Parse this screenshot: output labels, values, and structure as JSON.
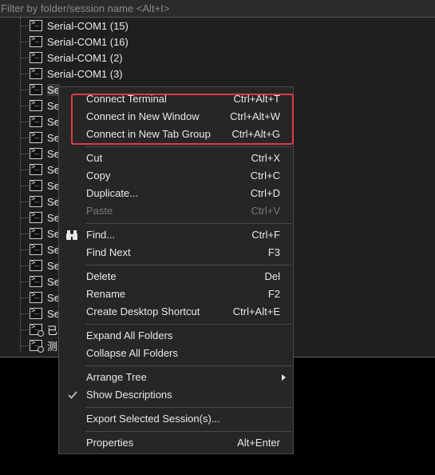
{
  "filter": {
    "placeholder": "Filter by folder/session name <Alt+I>"
  },
  "tree": {
    "items": [
      {
        "label": "Serial-COM1 (15)"
      },
      {
        "label": "Serial-COM1 (16)"
      },
      {
        "label": "Serial-COM1 (2)"
      },
      {
        "label": "Serial-COM1 (3)"
      },
      {
        "label": "Se"
      },
      {
        "label": "Se"
      },
      {
        "label": "Se"
      },
      {
        "label": "Se"
      },
      {
        "label": "Se"
      },
      {
        "label": "Se"
      },
      {
        "label": "Se"
      },
      {
        "label": "Se"
      },
      {
        "label": "Se"
      },
      {
        "label": "Se"
      },
      {
        "label": "Se"
      },
      {
        "label": "Se"
      },
      {
        "label": "Se"
      },
      {
        "label": "Se"
      },
      {
        "label": "Se"
      },
      {
        "label": "已"
      },
      {
        "label": "测"
      }
    ]
  },
  "context_menu": {
    "connect_terminal": {
      "label": "Connect Terminal",
      "shortcut": "Ctrl+Alt+T"
    },
    "connect_new_window": {
      "label": "Connect in New Window",
      "shortcut": "Ctrl+Alt+W"
    },
    "connect_new_tab_group": {
      "label": "Connect in New Tab Group",
      "shortcut": "Ctrl+Alt+G"
    },
    "cut": {
      "label": "Cut",
      "shortcut": "Ctrl+X"
    },
    "copy": {
      "label": "Copy",
      "shortcut": "Ctrl+C"
    },
    "duplicate": {
      "label": "Duplicate...",
      "shortcut": "Ctrl+D"
    },
    "paste": {
      "label": "Paste",
      "shortcut": "Ctrl+V"
    },
    "find": {
      "label": "Find...",
      "shortcut": "Ctrl+F"
    },
    "find_next": {
      "label": "Find Next",
      "shortcut": "F3"
    },
    "delete": {
      "label": "Delete",
      "shortcut": "Del"
    },
    "rename": {
      "label": "Rename",
      "shortcut": "F2"
    },
    "create_shortcut": {
      "label": "Create Desktop Shortcut",
      "shortcut": "Ctrl+Alt+E"
    },
    "expand_all": {
      "label": "Expand All Folders"
    },
    "collapse_all": {
      "label": "Collapse All Folders"
    },
    "arrange_tree": {
      "label": "Arrange Tree"
    },
    "show_descriptions": {
      "label": "Show Descriptions",
      "checked": true
    },
    "export_selected": {
      "label": "Export Selected Session(s)..."
    },
    "properties": {
      "label": "Properties",
      "shortcut": "Alt+Enter"
    }
  },
  "colors": {
    "highlight_border": "#e0394b",
    "menu_bg": "#262626",
    "panel_bg": "#1f1f1f"
  }
}
